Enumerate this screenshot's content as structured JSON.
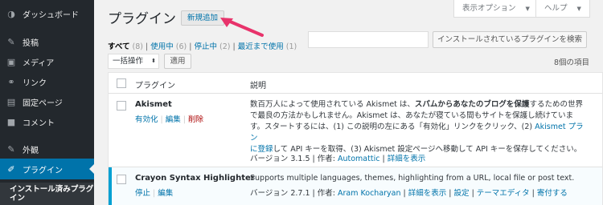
{
  "sidebar": {
    "items": [
      {
        "label": "ダッシュボード",
        "icon": "dashboard-icon",
        "glyph": "◑"
      },
      {
        "label": "投稿",
        "icon": "pin-icon",
        "glyph": "✎"
      },
      {
        "label": "メディア",
        "icon": "media-icon",
        "glyph": "▣"
      },
      {
        "label": "リンク",
        "icon": "link-icon",
        "glyph": "⚭"
      },
      {
        "label": "固定ページ",
        "icon": "page-icon",
        "glyph": "▤"
      },
      {
        "label": "コメント",
        "icon": "comment-icon",
        "glyph": "■"
      },
      {
        "label": "外観",
        "icon": "appearance-icon",
        "glyph": "✎"
      },
      {
        "label": "プラグイン",
        "icon": "plugin-icon",
        "glyph": "✐"
      }
    ],
    "sub_label": "インストール済みプラグイン"
  },
  "header": {
    "title": "プラグイン",
    "add_new": "新規追加",
    "screen_options": "表示オプション",
    "help": "ヘルプ"
  },
  "filters": {
    "all": "すべて",
    "all_count": "(8)",
    "active": "使用中",
    "active_count": "(6)",
    "inactive": "停止中",
    "inactive_count": "(2)",
    "recent": "最近まで使用",
    "recent_count": "(1)"
  },
  "search": {
    "button": "インストールされているプラグインを検索",
    "placeholder": ""
  },
  "bulk": {
    "select": "一括操作",
    "apply": "適用",
    "count": "8個の項目"
  },
  "table": {
    "col_plugin": "プラグイン",
    "col_desc": "説明",
    "rows": [
      {
        "name": "Akismet",
        "actions": [
          "有効化",
          "編集",
          "削除"
        ],
        "desc_line1_a": "数百万人によって使用されている Akismet は、",
        "desc_line1_b": "スパムからあなたのブログを保護",
        "desc_line1_c": "するための世界",
        "desc_line2": "で最良の方法かもしれません。Akismet は、あなたが寝ている間もサイトを保護し続けていま",
        "desc_line3_a": "す。スタートするには、(1) この説明の左にある「有効化」リンクをクリック、(2) ",
        "desc_line3_link": "Akismet プラン",
        "desc_line4_link": "に登録",
        "desc_line4_b": "して API キーを取得、(3) Akismet 設定ページへ移動して API キーを保存してください。",
        "version": "バージョン 3.1.5",
        "author_label": "作者:",
        "author": "Automattic",
        "details": "詳細を表示"
      },
      {
        "name": "Crayon Syntax Highlighter",
        "actions": [
          "停止",
          "編集"
        ],
        "desc": "Supports multiple languages, themes, highlighting from a URL, local file or post text.",
        "version": "バージョン 2.7.1",
        "author_label": "作者:",
        "author": "Aram Kocharyan",
        "details": "詳細を表示",
        "settings": "設定",
        "theme_editor": "テーマエディタ",
        "donate": "寄付する"
      }
    ]
  },
  "colors": {
    "accent": "#0073aa",
    "sidebar": "#23282d",
    "active_bar": "#00a0d2",
    "annotation_arrow": "#e8336b"
  }
}
